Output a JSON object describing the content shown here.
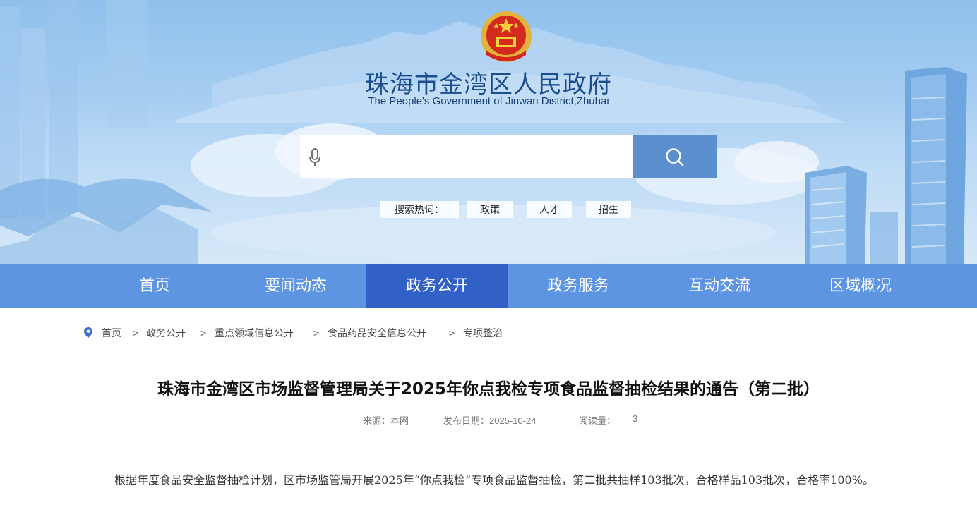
{
  "header": {
    "title": "珠海市金湾区人民政府",
    "subtitle": "The People's Government of Jinwan District,Zhuhai",
    "emblem_icon": "national-emblem-icon"
  },
  "search": {
    "placeholder": "",
    "mic_icon": "microphone-icon",
    "button_icon": "search-icon",
    "hot_label": "搜索热词：",
    "hotwords": [
      "政策",
      "人才",
      "招生"
    ]
  },
  "nav": {
    "items": [
      "首页",
      "要闻动态",
      "政务公开",
      "政务服务",
      "互动交流",
      "区域概况"
    ],
    "active": "政务公开"
  },
  "breadcrumb": {
    "icon": "location-pin-icon",
    "items": [
      "首页",
      "政务公开",
      "重点领域信息公开",
      "食品药品安全信息公开",
      "专项整治"
    ],
    "separator": ">"
  },
  "article": {
    "title": "珠海市金湾区市场监督管理局关于2025年你点我检专项食品监督抽检结果的通告（第二批）",
    "source": "来源：本网",
    "date": "发布日期：2025-10-24",
    "views_label": "阅读量：",
    "views": "3",
    "body": "根据年度食品安全监督抽检计划，区市场监管局开展2025年“你点我检”专项食品监督抽检，第二批共抽样103批次，合格样品103批次，合格率100%。"
  },
  "colors": {
    "nav_bg": "#5d95e3",
    "nav_active": "#3160c6",
    "title_blue": "#1b4d8f",
    "search_button": "#5b8fd0"
  }
}
